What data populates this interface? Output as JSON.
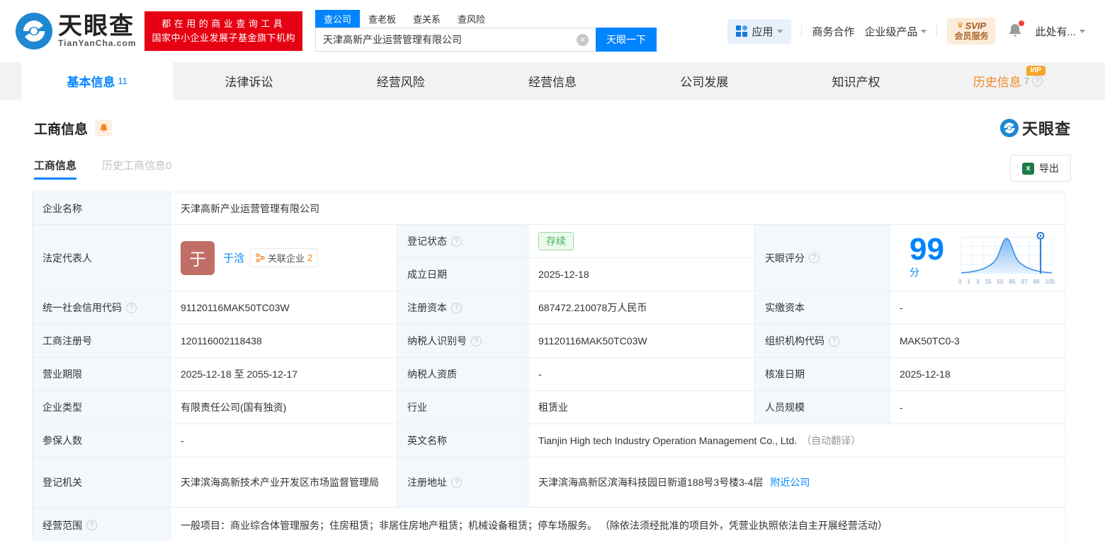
{
  "header": {
    "logo": {
      "brand": "天眼查",
      "domain": "TianYanCha.com"
    },
    "promo": {
      "line1": "都在用的商业查询工具",
      "line2": "国家中小企业发展子基金旗下机构"
    },
    "search": {
      "tabs": [
        {
          "label": "查公司"
        },
        {
          "label": "查老板"
        },
        {
          "label": "查关系"
        },
        {
          "label": "查风险"
        }
      ],
      "value": "天津高新产业运营管理有限公司",
      "button": "天眼一下"
    },
    "nav": {
      "apps": "应用",
      "cooperation": "商务合作",
      "enterprise": "企业级产品",
      "svip": "SVIP",
      "svip_sub": "会员服务",
      "user": "此处有..."
    }
  },
  "page_tabs": [
    {
      "label": "基本信息",
      "count": "11"
    },
    {
      "label": "法律诉讼"
    },
    {
      "label": "经营风险"
    },
    {
      "label": "经营信息"
    },
    {
      "label": "公司发展"
    },
    {
      "label": "知识产权"
    },
    {
      "label": "历史信息",
      "count": "7",
      "vip": "VIP"
    }
  ],
  "section": {
    "title": "工商信息",
    "watermark": "天眼查",
    "subtab_active": "工商信息",
    "subtab_history": "历史工商信息0",
    "export_label": "导出"
  },
  "info": {
    "company_name_label": "企业名称",
    "company_name": "天津高新产业运营管理有限公司",
    "legal_rep_label": "法定代表人",
    "legal_rep_avatar": "于",
    "legal_rep_name": "于浛",
    "related_label": "关联企业",
    "related_count": "2",
    "reg_status_label": "登记状态",
    "reg_status": "存续",
    "establish_date_label": "成立日期",
    "establish_date": "2025-12-18",
    "score_label": "天眼评分",
    "score": "99",
    "score_unit": "分",
    "credit_code_label": "统一社会信用代码",
    "credit_code": "91120116MAK50TC03W",
    "reg_capital_label": "注册资本",
    "reg_capital": "687472.210078万人民币",
    "paid_capital_label": "实缴资本",
    "paid_capital": "-",
    "reg_number_label": "工商注册号",
    "reg_number": "120116002118438",
    "taxpayer_id_label": "纳税人识别号",
    "taxpayer_id": "91120116MAK50TC03W",
    "org_code_label": "组织机构代码",
    "org_code": "MAK50TC0-3",
    "business_term_label": "营业期限",
    "business_term": "2025-12-18 至 2055-12-17",
    "taxpayer_quality_label": "纳税人资质",
    "taxpayer_quality": "-",
    "approval_date_label": "核准日期",
    "approval_date": "2025-12-18",
    "company_type_label": "企业类型",
    "company_type": "有限责任公司(国有独资)",
    "industry_label": "行业",
    "industry": "租赁业",
    "staff_size_label": "人员规模",
    "staff_size": "-",
    "insured_label": "参保人数",
    "insured": "-",
    "english_name_label": "英文名称",
    "english_name": "Tianjin High tech Industry Operation Management Co., Ltd.",
    "english_name_note": "（自动翻译）",
    "reg_authority_label": "登记机关",
    "reg_authority": "天津滨海高新技术产业开发区市场监督管理局",
    "reg_address_label": "注册地址",
    "reg_address": "天津滨海高新区滨海科技园日新道188号3号楼3-4层",
    "nearby_link": "附近公司",
    "business_scope_label": "经营范围",
    "business_scope": "一般项目：商业综合体管理服务；住房租赁；非居住房地产租赁；机械设备租赁；停车场服务。 （除依法须经批准的项目外，凭营业执照依法自主开展经营活动）"
  },
  "chart_data": {
    "type": "area",
    "title": "天眼评分分布曲线",
    "x_ticks": [
      "0",
      "1",
      "3",
      "15",
      "50",
      "85",
      "97",
      "99",
      "100"
    ],
    "marker_value": 99,
    "score": 99,
    "curve": "normal-distribution",
    "legend_position": "none",
    "grid": true,
    "colors": {
      "line": "#3d93e8",
      "fill_top": "#7db8f0",
      "fill_bottom": "#eaf4fe",
      "marker": "#2f7fd1"
    }
  },
  "colors": {
    "accent": "#0084ff",
    "orange": "#f08723",
    "green": "#43b254",
    "red": "#e60012"
  }
}
